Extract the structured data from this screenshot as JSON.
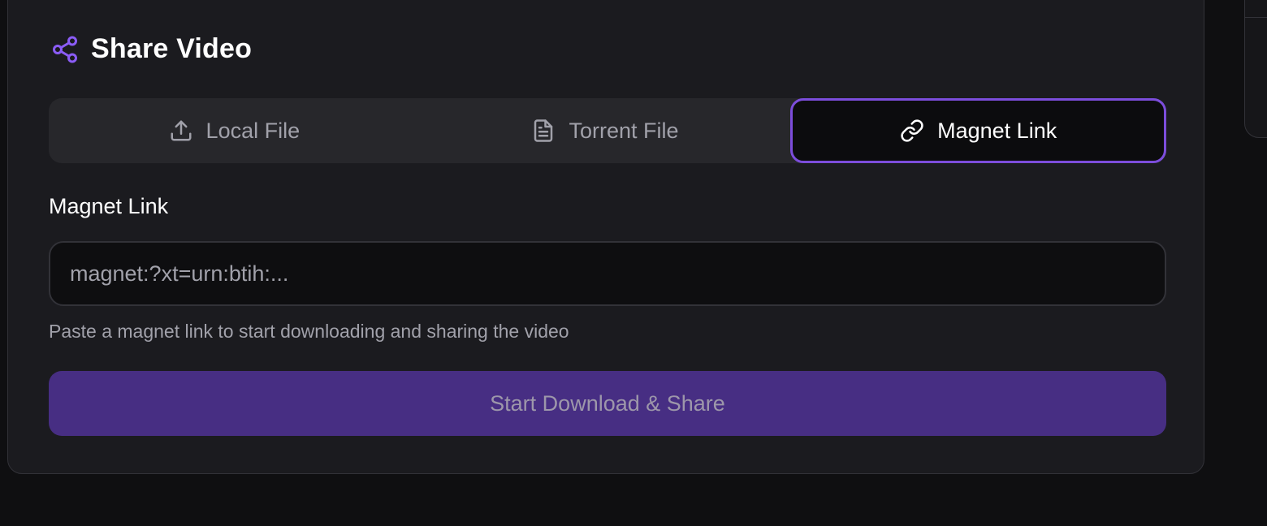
{
  "header": {
    "icon": "share-icon",
    "title": "Share Video"
  },
  "tabs": [
    {
      "label": "Local File",
      "icon": "upload-icon",
      "active": false
    },
    {
      "label": "Torrent File",
      "icon": "file-text-icon",
      "active": false
    },
    {
      "label": "Magnet Link",
      "icon": "link-icon",
      "active": true
    }
  ],
  "form": {
    "label": "Magnet Link",
    "placeholder": "magnet:?xt=urn:btih:...",
    "value": "",
    "hint": "Paste a magnet link to start downloading and sharing the video",
    "submit_label": "Start Download & Share"
  },
  "colors": {
    "accent": "#7c4ddb",
    "button_bg": "#472e83",
    "card_bg": "#1b1b1f",
    "page_bg": "#0f0f11"
  }
}
